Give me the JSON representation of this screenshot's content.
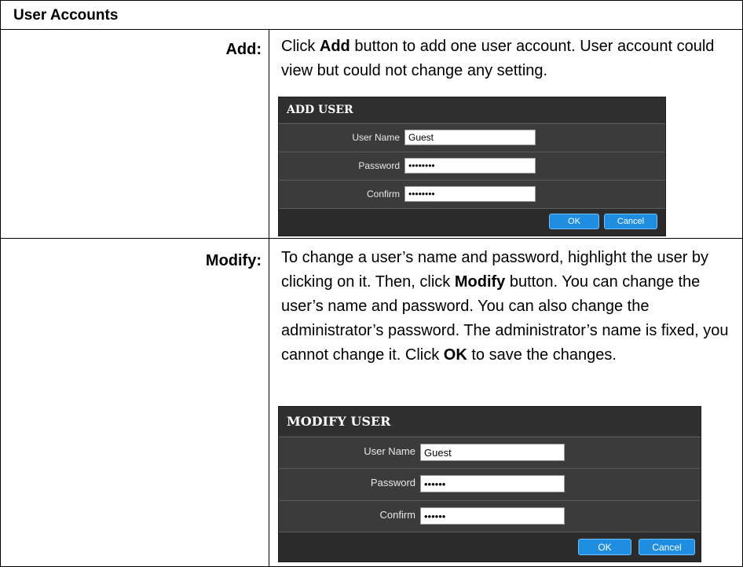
{
  "header": {
    "title": "User Accounts"
  },
  "rows": [
    {
      "label": "Add:",
      "text_before": "Click ",
      "bold": "Add",
      "text_after": " button to add one user account. User account could view but could not change any setting.",
      "dialog": {
        "title": "ADD USER",
        "fields": [
          {
            "label": "User Name",
            "value": "Guest"
          },
          {
            "label": "Password",
            "value": "••••••••"
          },
          {
            "label": "Confirm",
            "value": "••••••••"
          }
        ],
        "ok_label": "OK",
        "cancel_label": "Cancel"
      }
    },
    {
      "label": "Modify:",
      "text_1": "To change a user’s name and password, highlight the user by clicking on it. Then, click ",
      "bold_1": "Modify",
      "text_2": " button. You can change the user’s name and password. You can also change the administrator’s password.  The administrator’s name is fixed, you cannot change it. Click ",
      "bold_2": "OK",
      "text_3": " to save the changes.",
      "dialog": {
        "title": "MODIFY USER",
        "fields": [
          {
            "label": "User Name",
            "value": "Guest"
          },
          {
            "label": "Password",
            "value": "••••••"
          },
          {
            "label": "Confirm",
            "value": "••••••"
          }
        ],
        "ok_label": "OK",
        "cancel_label": "Cancel"
      }
    }
  ]
}
